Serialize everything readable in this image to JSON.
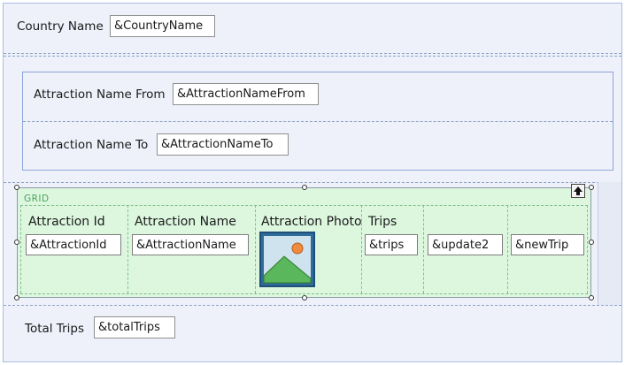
{
  "header": {
    "label": "Country Name",
    "field": "&CountryName"
  },
  "filters": {
    "from": {
      "label": "Attraction Name From",
      "field": "&AttractionNameFrom"
    },
    "to": {
      "label": "Attraction Name To",
      "field": "&AttractionNameTo"
    }
  },
  "grid": {
    "tag": "GRID",
    "columns": [
      {
        "header": "Attraction Id",
        "field": "&AttractionId"
      },
      {
        "header": "Attraction Name",
        "field": "&AttractionName"
      },
      {
        "header": "Attraction Photo",
        "field": ""
      },
      {
        "header": "Trips",
        "field": "&trips"
      },
      {
        "header": "",
        "field": "&update2"
      },
      {
        "header": "",
        "field": "&newTrip"
      }
    ],
    "photo_icon": "image-placeholder-icon",
    "collapse_icon": "arrow-up-icon"
  },
  "footer": {
    "label": "Total Trips",
    "field": "&totalTrips"
  },
  "colors": {
    "grid_bg": "#ddf7df",
    "grid_tag": "#4aa35a",
    "panel_bg": "#eef1fa",
    "panel_border": "#8ea6d8"
  }
}
